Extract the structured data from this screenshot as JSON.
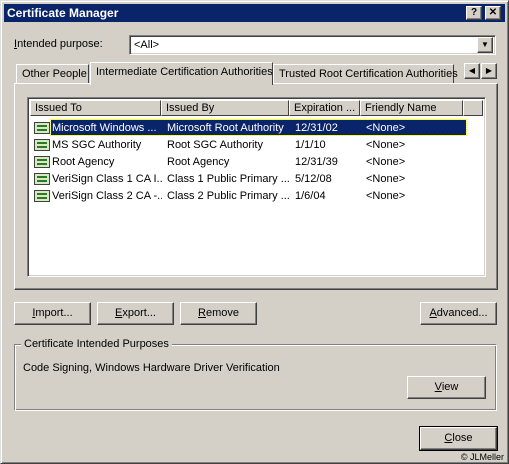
{
  "window": {
    "title": "Certificate Manager",
    "help_glyph": "?",
    "close_glyph": "✕"
  },
  "purpose": {
    "label_key": "I",
    "label_rest": "ntended purpose:",
    "value": "<All>"
  },
  "tabs": [
    {
      "label": "Other People",
      "active": false
    },
    {
      "label": "Intermediate Certification Authorities",
      "active": true
    },
    {
      "label": "Trusted Root Certification Authorities",
      "active": false
    }
  ],
  "tab_scroll": {
    "left_glyph": "◀",
    "right_glyph": "▶"
  },
  "columns": [
    "Issued To",
    "Issued By",
    "Expiration ...",
    "Friendly Name"
  ],
  "rows": [
    {
      "issued_to": "Microsoft Windows ...",
      "issued_by": "Microsoft Root Authority",
      "expiration": "12/31/02",
      "friendly": "<None>",
      "selected": true
    },
    {
      "issued_to": "MS SGC Authority",
      "issued_by": "Root SGC Authority",
      "expiration": "1/1/10",
      "friendly": "<None>",
      "selected": false
    },
    {
      "issued_to": "Root Agency",
      "issued_by": "Root Agency",
      "expiration": "12/31/39",
      "friendly": "<None>",
      "selected": false
    },
    {
      "issued_to": "VeriSign Class 1 CA I...",
      "issued_by": "Class 1 Public Primary ...",
      "expiration": "5/12/08",
      "friendly": "<None>",
      "selected": false
    },
    {
      "issued_to": "VeriSign Class 2 CA -...",
      "issued_by": "Class 2 Public Primary ...",
      "expiration": "1/6/04",
      "friendly": "<None>",
      "selected": false
    }
  ],
  "buttons": {
    "import": {
      "key": "I",
      "rest": "mport..."
    },
    "export": {
      "key": "E",
      "rest": "xport..."
    },
    "remove": {
      "key": "R",
      "rest": "emove"
    },
    "advanced": {
      "key": "A",
      "rest": "dvanced..."
    },
    "view": {
      "key": "V",
      "rest": "iew"
    },
    "close": {
      "key": "C",
      "rest": "lose"
    }
  },
  "purposes_group": {
    "title": "Certificate Intended Purposes",
    "text": "Code Signing, Windows Hardware Driver Verification"
  },
  "watermark": "© JLMeller",
  "colors": {
    "titlebar": "#0a246a",
    "face": "#d4d0c8",
    "selection": "#0a246a"
  }
}
